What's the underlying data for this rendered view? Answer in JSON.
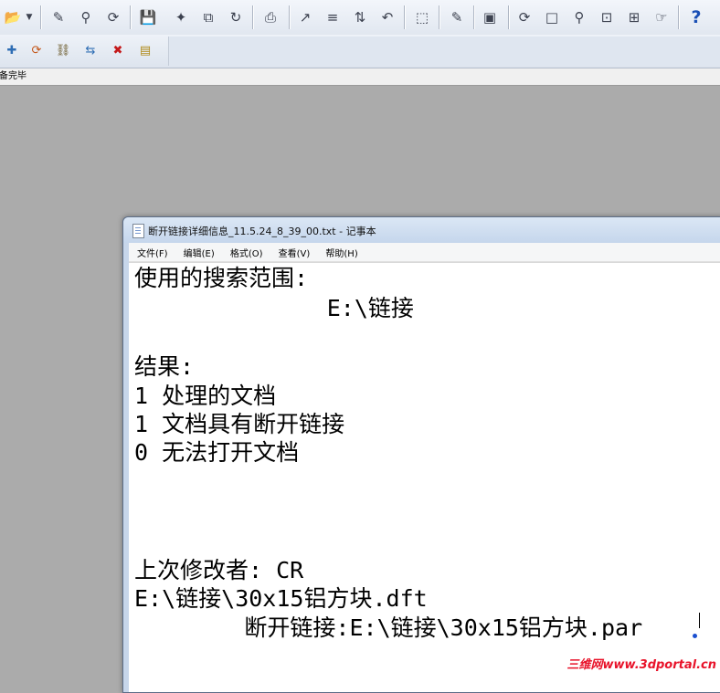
{
  "app": {
    "toolbar1": {
      "icons": [
        "open-icon",
        "dropdown-arrow-icon",
        "edit-link-icon",
        "inspect-icon",
        "refresh-icon",
        "save-icon",
        "new-doc-icon",
        "copy-icon",
        "link-icon",
        "print-icon",
        "select-cursor-icon",
        "number-list-icon",
        "sort-icon",
        "undo-icon",
        "select-box-icon",
        "marker-icon",
        "capture-icon",
        "rotate-view-icon",
        "zoom-area-icon",
        "zoom-icon",
        "fit-icon",
        "pan-icon",
        "tool-icon",
        "help-icon"
      ],
      "help_label": "?"
    },
    "toolbar2": {
      "icons": [
        "add-link-icon",
        "relink-icon",
        "chain-icon",
        "move-link-icon",
        "break-link-icon",
        "list-links-icon"
      ]
    },
    "status_text": "备完毕"
  },
  "notepad": {
    "title": "断开链接详细信息_11.5.24_8_39_00.txt - 记事本",
    "menu": [
      "文件(F)",
      "编辑(E)",
      "格式(O)",
      "查看(V)",
      "帮助(H)"
    ],
    "lines": [
      "使用的搜索范围:",
      "              E:\\链接",
      "",
      "结果:",
      "1 处理的文档",
      "1 文档具有断开链接",
      "0 无法打开文档",
      "",
      "",
      "",
      "上次修改者: CR",
      "E:\\链接\\30x15铝方块.dft",
      "        断开链接:E:\\链接\\30x15铝方块.par"
    ]
  },
  "watermark": "三维网www.3dportal.cn"
}
